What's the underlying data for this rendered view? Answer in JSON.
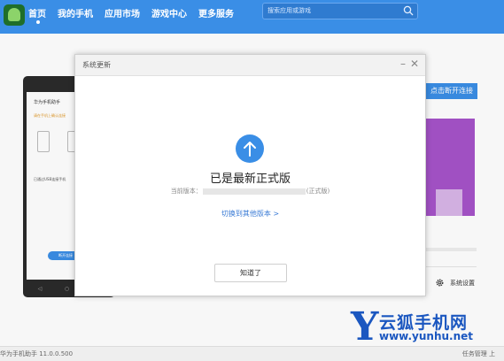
{
  "nav": {
    "items": [
      {
        "label": "首页",
        "active": true
      },
      {
        "label": "我的手机",
        "active": false
      },
      {
        "label": "应用市场",
        "active": false
      },
      {
        "label": "游戏中心",
        "active": false
      },
      {
        "label": "更多服务",
        "active": false
      }
    ]
  },
  "search": {
    "placeholder": "搜索应用或游戏",
    "icon": "search-icon"
  },
  "background": {
    "phone": {
      "title": "华为手机助手",
      "notice": "请在手机上确认连接",
      "text": "已通过USB连接手机",
      "button": "断开连接",
      "navbar": [
        "◁",
        "○",
        "□"
      ]
    },
    "disconnect_button": "点击断开连接",
    "settings": {
      "icon": "gear-icon",
      "label": "系统设置"
    }
  },
  "statusbar": {
    "left": "华为手机助手 11.0.0.500",
    "right": "任务管理  上"
  },
  "dialog": {
    "title": "系统更新",
    "minimize": "–",
    "close": "✕",
    "heading": "已是最新正式版",
    "version_prefix": "当前版本：",
    "version_suffix": "(正式版)",
    "switch_link": "切换到其他版本 >",
    "ok_button": "知道了",
    "icon": "upload-arrow-icon"
  },
  "watermark": {
    "letter": "Y",
    "name": "云狐手机网",
    "url": "www.yunhu.net"
  },
  "colors": {
    "accent": "#3a8ee6",
    "banner": "#a653c9",
    "link": "#3a7bd5",
    "watermark": "#1c5ac7"
  }
}
